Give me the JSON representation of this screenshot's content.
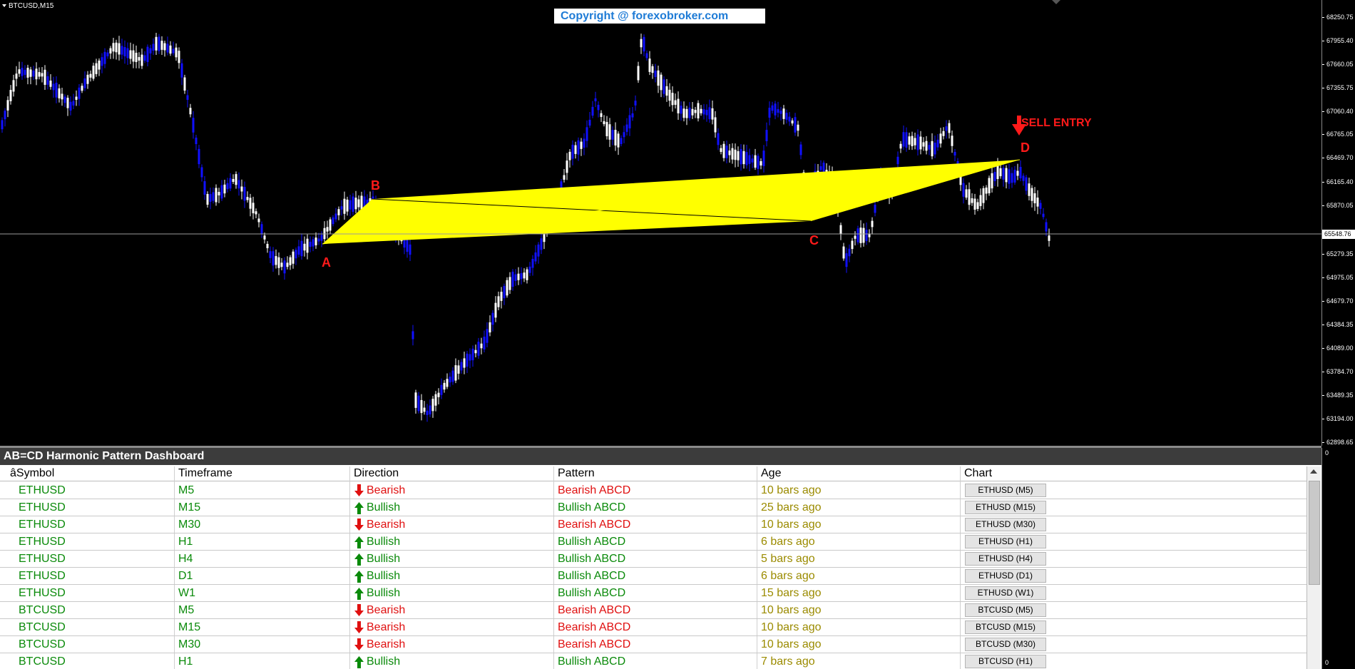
{
  "chart": {
    "symbol_label": "BTCUSD,M15",
    "copyright": "Copyright @ forexobroker.com",
    "sell_entry": "SELL ENTRY",
    "point_labels": {
      "a": "A",
      "b": "B",
      "c": "C",
      "d": "D"
    },
    "price_ticks": [
      "68250.75",
      "67955.40",
      "67660.05",
      "67355.75",
      "67060.40",
      "66765.05",
      "66469.70",
      "66165.40",
      "65870.05",
      "65279.35",
      "64975.05",
      "64679.70",
      "64384.35",
      "64089.00",
      "63784.70",
      "63489.35",
      "63194.00",
      "62898.65"
    ],
    "current_price": "65548.76",
    "colors": {
      "bullish_candle": "#0000ff",
      "bearish_candle": "#ffffff",
      "pattern_fill": "#ffff00",
      "label_red": "#ff1a1a"
    }
  },
  "dashboard": {
    "title": "AB=CD Harmonic Pattern Dashboard",
    "columns": [
      "âSymbol",
      "Timeframe",
      "Direction",
      "Pattern",
      "Age",
      "Chart"
    ],
    "rows": [
      {
        "symbol": "ETHUSD",
        "timeframe": "M5",
        "direction": "Bearish",
        "pattern": "Bearish ABCD",
        "age": "10 bars ago",
        "chart": "ETHUSD (M5)"
      },
      {
        "symbol": "ETHUSD",
        "timeframe": "M15",
        "direction": "Bullish",
        "pattern": "Bullish ABCD",
        "age": "25 bars ago",
        "chart": "ETHUSD (M15)"
      },
      {
        "symbol": "ETHUSD",
        "timeframe": "M30",
        "direction": "Bearish",
        "pattern": "Bearish ABCD",
        "age": "10 bars ago",
        "chart": "ETHUSD (M30)"
      },
      {
        "symbol": "ETHUSD",
        "timeframe": "H1",
        "direction": "Bullish",
        "pattern": "Bullish ABCD",
        "age": "6 bars ago",
        "chart": "ETHUSD (H1)"
      },
      {
        "symbol": "ETHUSD",
        "timeframe": "H4",
        "direction": "Bullish",
        "pattern": "Bullish ABCD",
        "age": "5 bars ago",
        "chart": "ETHUSD (H4)"
      },
      {
        "symbol": "ETHUSD",
        "timeframe": "D1",
        "direction": "Bullish",
        "pattern": "Bullish ABCD",
        "age": "6 bars ago",
        "chart": "ETHUSD (D1)"
      },
      {
        "symbol": "ETHUSD",
        "timeframe": "W1",
        "direction": "Bullish",
        "pattern": "Bullish ABCD",
        "age": "15 bars ago",
        "chart": "ETHUSD (W1)"
      },
      {
        "symbol": "BTCUSD",
        "timeframe": "M5",
        "direction": "Bearish",
        "pattern": "Bearish ABCD",
        "age": "10 bars ago",
        "chart": "BTCUSD (M5)"
      },
      {
        "symbol": "BTCUSD",
        "timeframe": "M15",
        "direction": "Bearish",
        "pattern": "Bearish ABCD",
        "age": "10 bars ago",
        "chart": "BTCUSD (M15)"
      },
      {
        "symbol": "BTCUSD",
        "timeframe": "M30",
        "direction": "Bearish",
        "pattern": "Bearish ABCD",
        "age": "10 bars ago",
        "chart": "BTCUSD (M30)"
      },
      {
        "symbol": "BTCUSD",
        "timeframe": "H1",
        "direction": "Bullish",
        "pattern": "Bullish ABCD",
        "age": "7 bars ago",
        "chart": "BTCUSD (H1)"
      }
    ],
    "side_axis_top": "0",
    "side_axis_bottom": "0"
  }
}
